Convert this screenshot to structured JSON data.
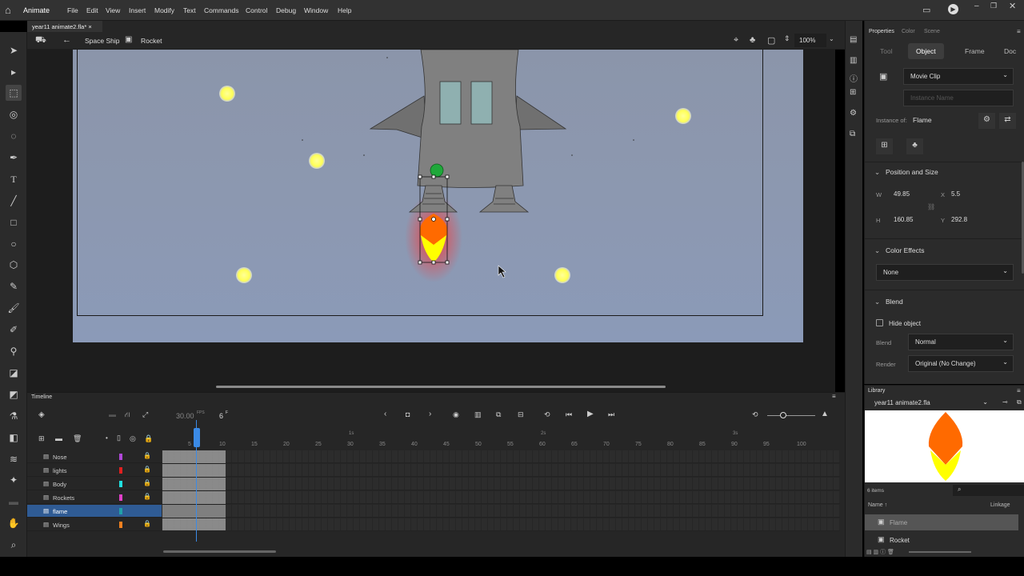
{
  "app": {
    "name": "Animate",
    "menus": [
      "File",
      "Edit",
      "View",
      "Insert",
      "Modify",
      "Text",
      "Commands",
      "Control",
      "Debug",
      "Window",
      "Help"
    ]
  },
  "document": {
    "tab_title": "year11 animate2.fla*",
    "tab_close": "×"
  },
  "breadcrumb": {
    "scene": "Space Ship",
    "symbol": "Rocket"
  },
  "zoom": "100%",
  "properties": {
    "top_tabs": [
      "Properties",
      "Color",
      "Scene"
    ],
    "sub_tabs": [
      "Tool",
      "Object",
      "Frame",
      "Doc"
    ],
    "active_sub_tab": "Object",
    "symbol_type": "Movie Clip",
    "instance_name_placeholder": "Instance Name",
    "instance_of_label": "Instance of:",
    "instance_of_value": "Flame",
    "position_size": {
      "title": "Position and Size",
      "w_label": "W",
      "w": "49.85",
      "x_label": "X",
      "x": "5.5",
      "h_label": "H",
      "h": "160.85",
      "y_label": "Y",
      "y": "292.8"
    },
    "color_effects": {
      "title": "Color Effects",
      "value": "None"
    },
    "blend": {
      "title": "Blend",
      "hide_object": "Hide object",
      "blend_label": "Blend",
      "blend_value": "Normal",
      "render_label": "Render",
      "render_value": "Original (No Change)"
    }
  },
  "library": {
    "title": "Library",
    "document": "year11 animate2.fla",
    "count": "6 items",
    "name_col": "Name ↑",
    "linkage_col": "Linkage",
    "items": [
      {
        "name": "Flame"
      },
      {
        "name": "Rocket"
      }
    ]
  },
  "timeline": {
    "title": "Timeline",
    "fps": "30.00",
    "fps_unit": "FPS",
    "current_frame": "6",
    "frame_unit": "F",
    "ruler": [
      "5",
      "10",
      "15",
      "20",
      "25",
      "30",
      "35",
      "40",
      "45",
      "50",
      "55",
      "60",
      "65",
      "70",
      "75",
      "80",
      "85",
      "90",
      "95",
      "100"
    ],
    "seconds": [
      "1s",
      "2s",
      "3s"
    ],
    "layers": [
      {
        "name": "Nose",
        "color": "#b048d8"
      },
      {
        "name": "lights",
        "color": "#e02020"
      },
      {
        "name": "Body",
        "color": "#20e0e0"
      },
      {
        "name": "Rockets",
        "color": "#e040c8"
      },
      {
        "name": "flame",
        "color": "#20a0a8"
      },
      {
        "name": "Wings",
        "color": "#f08020"
      }
    ]
  }
}
